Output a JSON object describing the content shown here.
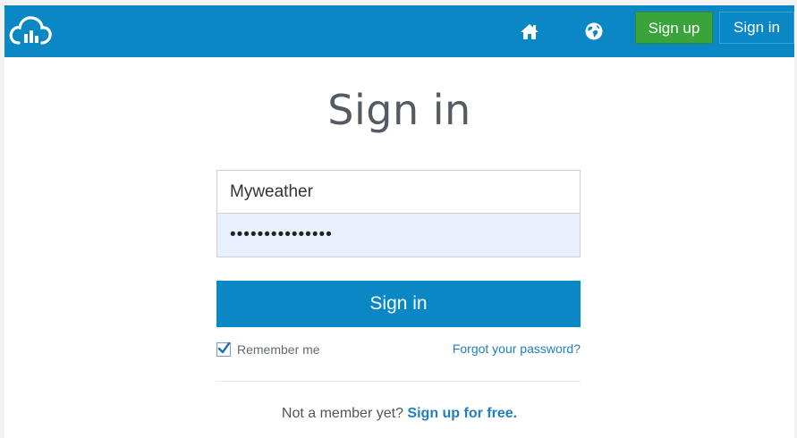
{
  "header": {
    "logo_icon": "cloud-chart-logo-icon",
    "home_icon": "home-icon",
    "globe_icon": "globe-icon",
    "signup_label": "Sign up",
    "signin_label": "Sign in",
    "bar_color": "#0a88c6",
    "signup_color": "#3aa33a"
  },
  "form": {
    "title": "Sign in",
    "username_value": "Myweather",
    "password_value": "•••••••••••••••",
    "submit_label": "Sign in",
    "remember_label": "Remember me",
    "remember_checked": true,
    "forgot_label": "Forgot your password?"
  },
  "footer": {
    "prompt": "Not a member yet?",
    "link": "Sign up for free."
  }
}
